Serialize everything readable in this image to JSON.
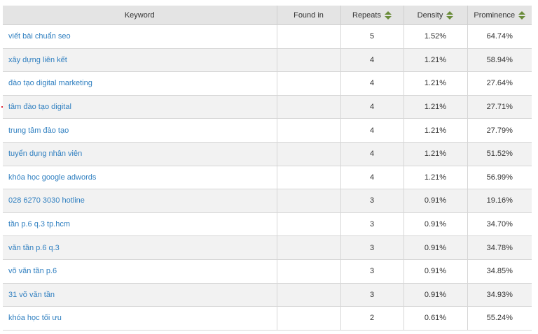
{
  "columns": {
    "keyword": "Keyword",
    "found_in": "Found in",
    "repeats": "Repeats",
    "density": "Density",
    "prominence": "Prominence"
  },
  "rows": [
    {
      "keyword": "viết bài chuẩn seo",
      "found_in": "",
      "repeats": "5",
      "density": "1.52%",
      "prominence": "64.74%"
    },
    {
      "keyword": "xây dựng liên kết",
      "found_in": "",
      "repeats": "4",
      "density": "1.21%",
      "prominence": "58.94%"
    },
    {
      "keyword": "đào tạo digital marketing",
      "found_in": "",
      "repeats": "4",
      "density": "1.21%",
      "prominence": "27.64%"
    },
    {
      "keyword": "tâm đào tạo digital",
      "found_in": "",
      "repeats": "4",
      "density": "1.21%",
      "prominence": "27.71%"
    },
    {
      "keyword": "trung tâm đào tạo",
      "found_in": "",
      "repeats": "4",
      "density": "1.21%",
      "prominence": "27.79%"
    },
    {
      "keyword": "tuyển dụng nhân viên",
      "found_in": "",
      "repeats": "4",
      "density": "1.21%",
      "prominence": "51.52%"
    },
    {
      "keyword": "khóa học google adwords",
      "found_in": "",
      "repeats": "4",
      "density": "1.21%",
      "prominence": "56.99%"
    },
    {
      "keyword": "028 6270 3030 hotline",
      "found_in": "",
      "repeats": "3",
      "density": "0.91%",
      "prominence": "19.16%"
    },
    {
      "keyword": "tần p.6 q.3 tp.hcm",
      "found_in": "",
      "repeats": "3",
      "density": "0.91%",
      "prominence": "34.70%"
    },
    {
      "keyword": "văn tần p.6 q.3",
      "found_in": "",
      "repeats": "3",
      "density": "0.91%",
      "prominence": "34.78%"
    },
    {
      "keyword": "võ văn tần p.6",
      "found_in": "",
      "repeats": "3",
      "density": "0.91%",
      "prominence": "34.85%"
    },
    {
      "keyword": "31 võ văn tần",
      "found_in": "",
      "repeats": "3",
      "density": "0.91%",
      "prominence": "34.93%"
    },
    {
      "keyword": "khóa học tối ưu",
      "found_in": "",
      "repeats": "2",
      "density": "0.61%",
      "prominence": "55.24%"
    }
  ],
  "colors": {
    "header_bg": "#e4e4e4",
    "link": "#2f7fc0",
    "sort_icon": "#6a8c3a",
    "row_alt": "#f2f2f2"
  },
  "icons": {
    "sort": "sort-updown-icon"
  }
}
